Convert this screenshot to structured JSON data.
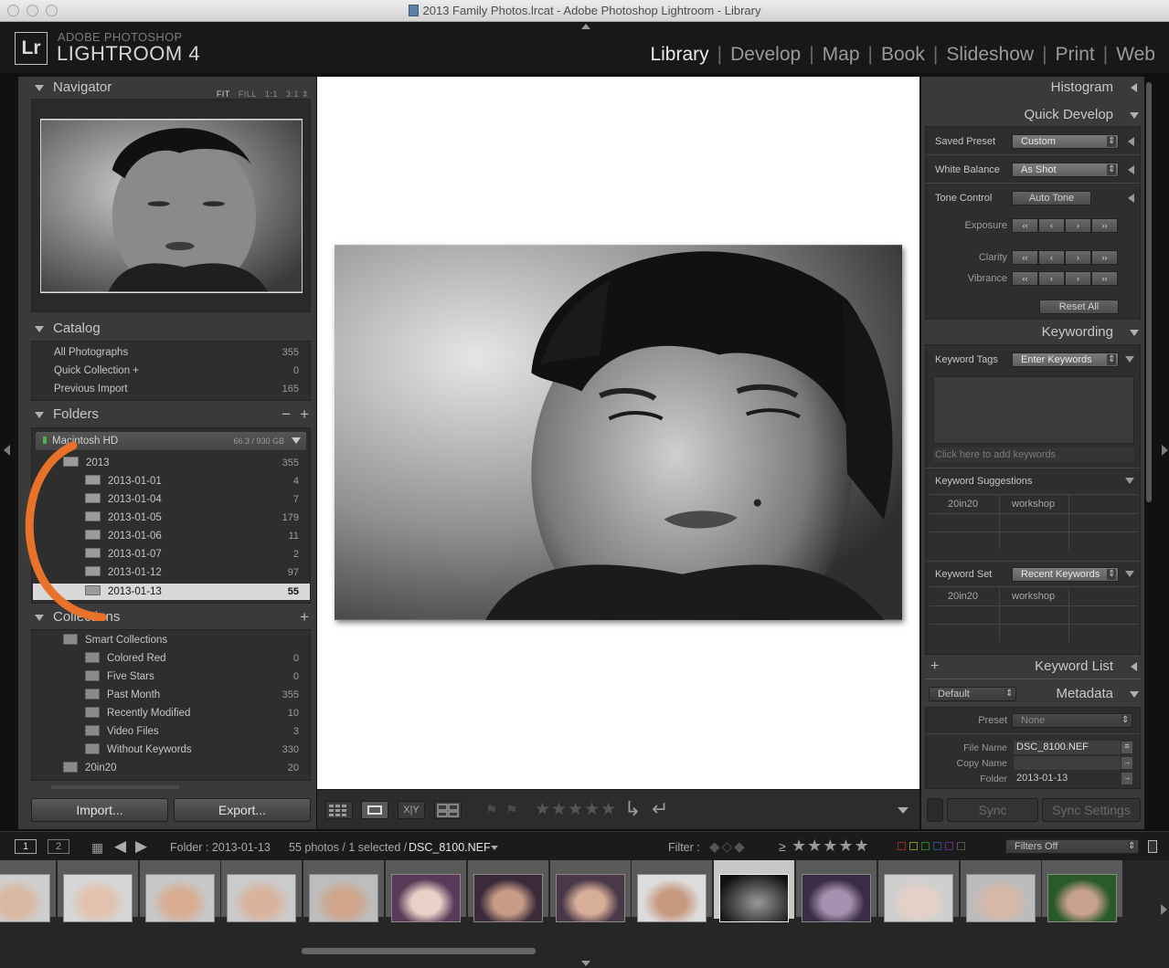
{
  "window": {
    "title": "2013 Family Photos.lrcat - Adobe Photoshop Lightroom - Library"
  },
  "brand": {
    "logo": "Lr",
    "line1": "ADOBE PHOTOSHOP",
    "line2": "LIGHTROOM 4"
  },
  "modules": [
    "Library",
    "Develop",
    "Map",
    "Book",
    "Slideshow",
    "Print",
    "Web"
  ],
  "navigator": {
    "title": "Navigator",
    "zoom": [
      "FIT",
      "FILL",
      "1:1",
      "3:1"
    ]
  },
  "catalog": {
    "title": "Catalog",
    "items": [
      {
        "label": "All Photographs",
        "count": "355"
      },
      {
        "label": "Quick Collection +",
        "count": "0"
      },
      {
        "label": "Previous Import",
        "count": "165"
      }
    ]
  },
  "folders": {
    "title": "Folders",
    "volume": {
      "label": "Macintosh HD",
      "size": "66.3 / 930 GB"
    },
    "root": {
      "label": "2013",
      "count": "355"
    },
    "items": [
      {
        "label": "2013-01-01",
        "count": "4"
      },
      {
        "label": "2013-01-04",
        "count": "7"
      },
      {
        "label": "2013-01-05",
        "count": "179"
      },
      {
        "label": "2013-01-06",
        "count": "11"
      },
      {
        "label": "2013-01-07",
        "count": "2"
      },
      {
        "label": "2013-01-12",
        "count": "97"
      },
      {
        "label": "2013-01-13",
        "count": "55"
      }
    ]
  },
  "collections": {
    "title": "Collections",
    "smart": "Smart Collections",
    "items": [
      {
        "label": "Colored Red",
        "count": "0"
      },
      {
        "label": "Five Stars",
        "count": "0"
      },
      {
        "label": "Past Month",
        "count": "355"
      },
      {
        "label": "Recently Modified",
        "count": "10"
      },
      {
        "label": "Video Files",
        "count": "3"
      },
      {
        "label": "Without Keywords",
        "count": "330"
      }
    ],
    "other": {
      "label": "20in20",
      "count": "20"
    }
  },
  "left_buttons": {
    "import": "Import...",
    "export": "Export..."
  },
  "histogram": {
    "title": "Histogram"
  },
  "quick_develop": {
    "title": "Quick Develop",
    "saved_preset_label": "Saved Preset",
    "saved_preset_value": "Custom",
    "white_balance_label": "White Balance",
    "white_balance_value": "As Shot",
    "tone_control_label": "Tone Control",
    "auto_tone": "Auto Tone",
    "exposure": "Exposure",
    "clarity": "Clarity",
    "vibrance": "Vibrance",
    "reset_all": "Reset All",
    "step_double_left": "‹‹",
    "step_left": "‹",
    "step_right": "›",
    "step_double_right": "››"
  },
  "keywording": {
    "title": "Keywording",
    "tags_label": "Keyword Tags",
    "tags_value": "Enter Keywords",
    "placeholder": "Click here to add keywords",
    "suggestions_label": "Keyword Suggestions",
    "suggestions": [
      "20in20",
      "workshop"
    ],
    "set_label": "Keyword Set",
    "set_value": "Recent Keywords",
    "set_items": [
      "20in20",
      "workshop"
    ]
  },
  "keyword_list": {
    "title": "Keyword List",
    "plus": "+"
  },
  "metadata": {
    "title": "Metadata",
    "preset_select": "Default",
    "preset_label": "Preset",
    "preset_value": "None",
    "file_name_label": "File Name",
    "file_name_value": "DSC_8100.NEF",
    "copy_name_label": "Copy Name",
    "folder_label": "Folder",
    "folder_value": "2013-01-13"
  },
  "right_buttons": {
    "sync": "Sync",
    "sync_settings": "Sync Settings"
  },
  "toolbar": {
    "xy": "X|Y",
    "stars": "★★★★★"
  },
  "filmstrip_bar": {
    "page1": "1",
    "page2": "2",
    "folder_label": "Folder : 2013-01-13",
    "photos": "55 photos / 1 selected /",
    "file": "DSC_8100.NEF",
    "filter_label": "Filter :",
    "rating_op": "≥",
    "filter_stars": "★★★★★",
    "filters_off": "Filters Off"
  },
  "filmstrip_count": 14,
  "colors": {
    "annotation_orange": "#e8722a",
    "panel_bg": "#3a3a3a",
    "selected_row": "#d8d8d8"
  }
}
